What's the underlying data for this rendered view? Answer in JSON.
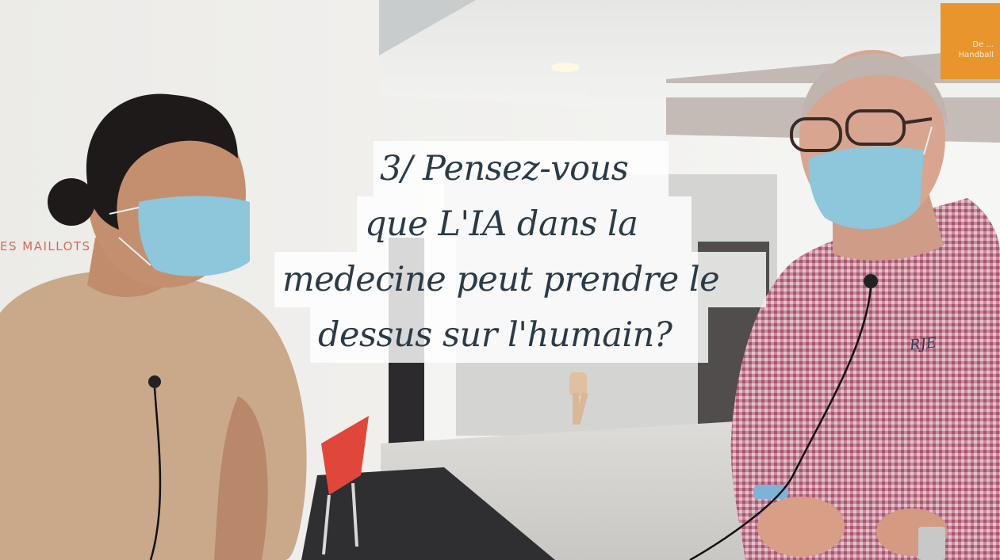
{
  "wall_text": "ES MAILLOTS",
  "sign_text": "De ...\nHandball",
  "shirt_logo": "RJE",
  "caption": {
    "line1": "3/ Pensez-vous",
    "line2": "que L'IA dans la",
    "line3": "medecine peut prendre le",
    "line4": "dessus sur l'humain?"
  },
  "colors": {
    "caption_text": "#2b3a47",
    "caption_bg": "#ffffff",
    "wall_text": "#d46a5e",
    "sign_orange": "#e8952e",
    "shirt_check": "#a8566f",
    "tshirt_beige": "#c9a98a",
    "mask_blue": "#8ec6dc"
  },
  "icons": [
    "lapel-microphone-icon",
    "lapel-microphone-icon"
  ]
}
